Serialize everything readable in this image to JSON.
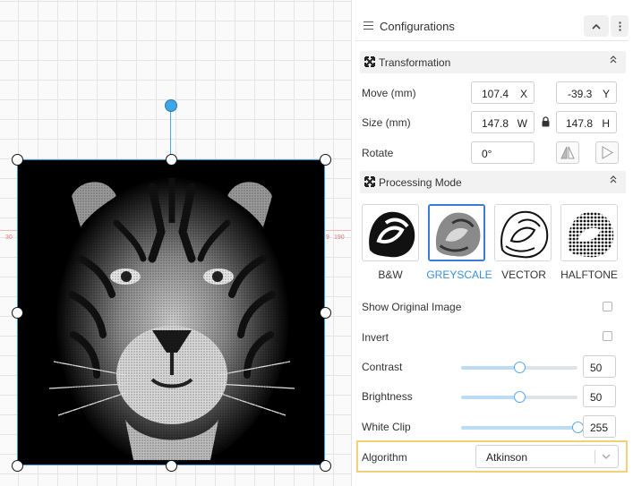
{
  "canvas": {
    "ruler_labels": [
      "30",
      "9",
      "190"
    ]
  },
  "panel": {
    "title": "Configurations",
    "collapse_icon": "chevron-up-icon",
    "menu_icon": "kebab-menu-icon"
  },
  "transformation": {
    "title": "Transformation",
    "move": {
      "label": "Move (mm)",
      "x": "107.4",
      "x_unit": "X",
      "y": "-39.3",
      "y_unit": "Y"
    },
    "size": {
      "label": "Size (mm)",
      "w": "147.8",
      "w_unit": "W",
      "h": "147.8",
      "h_unit": "H"
    },
    "rotate": {
      "label": "Rotate",
      "value": "0°"
    }
  },
  "processing": {
    "title": "Processing Mode",
    "modes": [
      {
        "label": "B&W",
        "active": false
      },
      {
        "label": "GREYSCALE",
        "active": true
      },
      {
        "label": "VECTOR",
        "active": false
      },
      {
        "label": "HALFTONE",
        "active": false
      }
    ],
    "show_original": {
      "label": "Show Original Image",
      "checked": false
    },
    "invert": {
      "label": "Invert",
      "checked": false
    },
    "contrast": {
      "label": "Contrast",
      "value": "50",
      "fraction": 0.5
    },
    "brightness": {
      "label": "Brightness",
      "value": "50",
      "fraction": 0.5
    },
    "white_clip": {
      "label": "White Clip",
      "value": "255",
      "fraction": 1.0
    },
    "algorithm": {
      "label": "Algorithm",
      "value": "Atkinson"
    }
  },
  "colors": {
    "accent": "#3a8fd9",
    "highlight_border": "#f3d07a",
    "selection_handle": "#3ea6e8"
  }
}
